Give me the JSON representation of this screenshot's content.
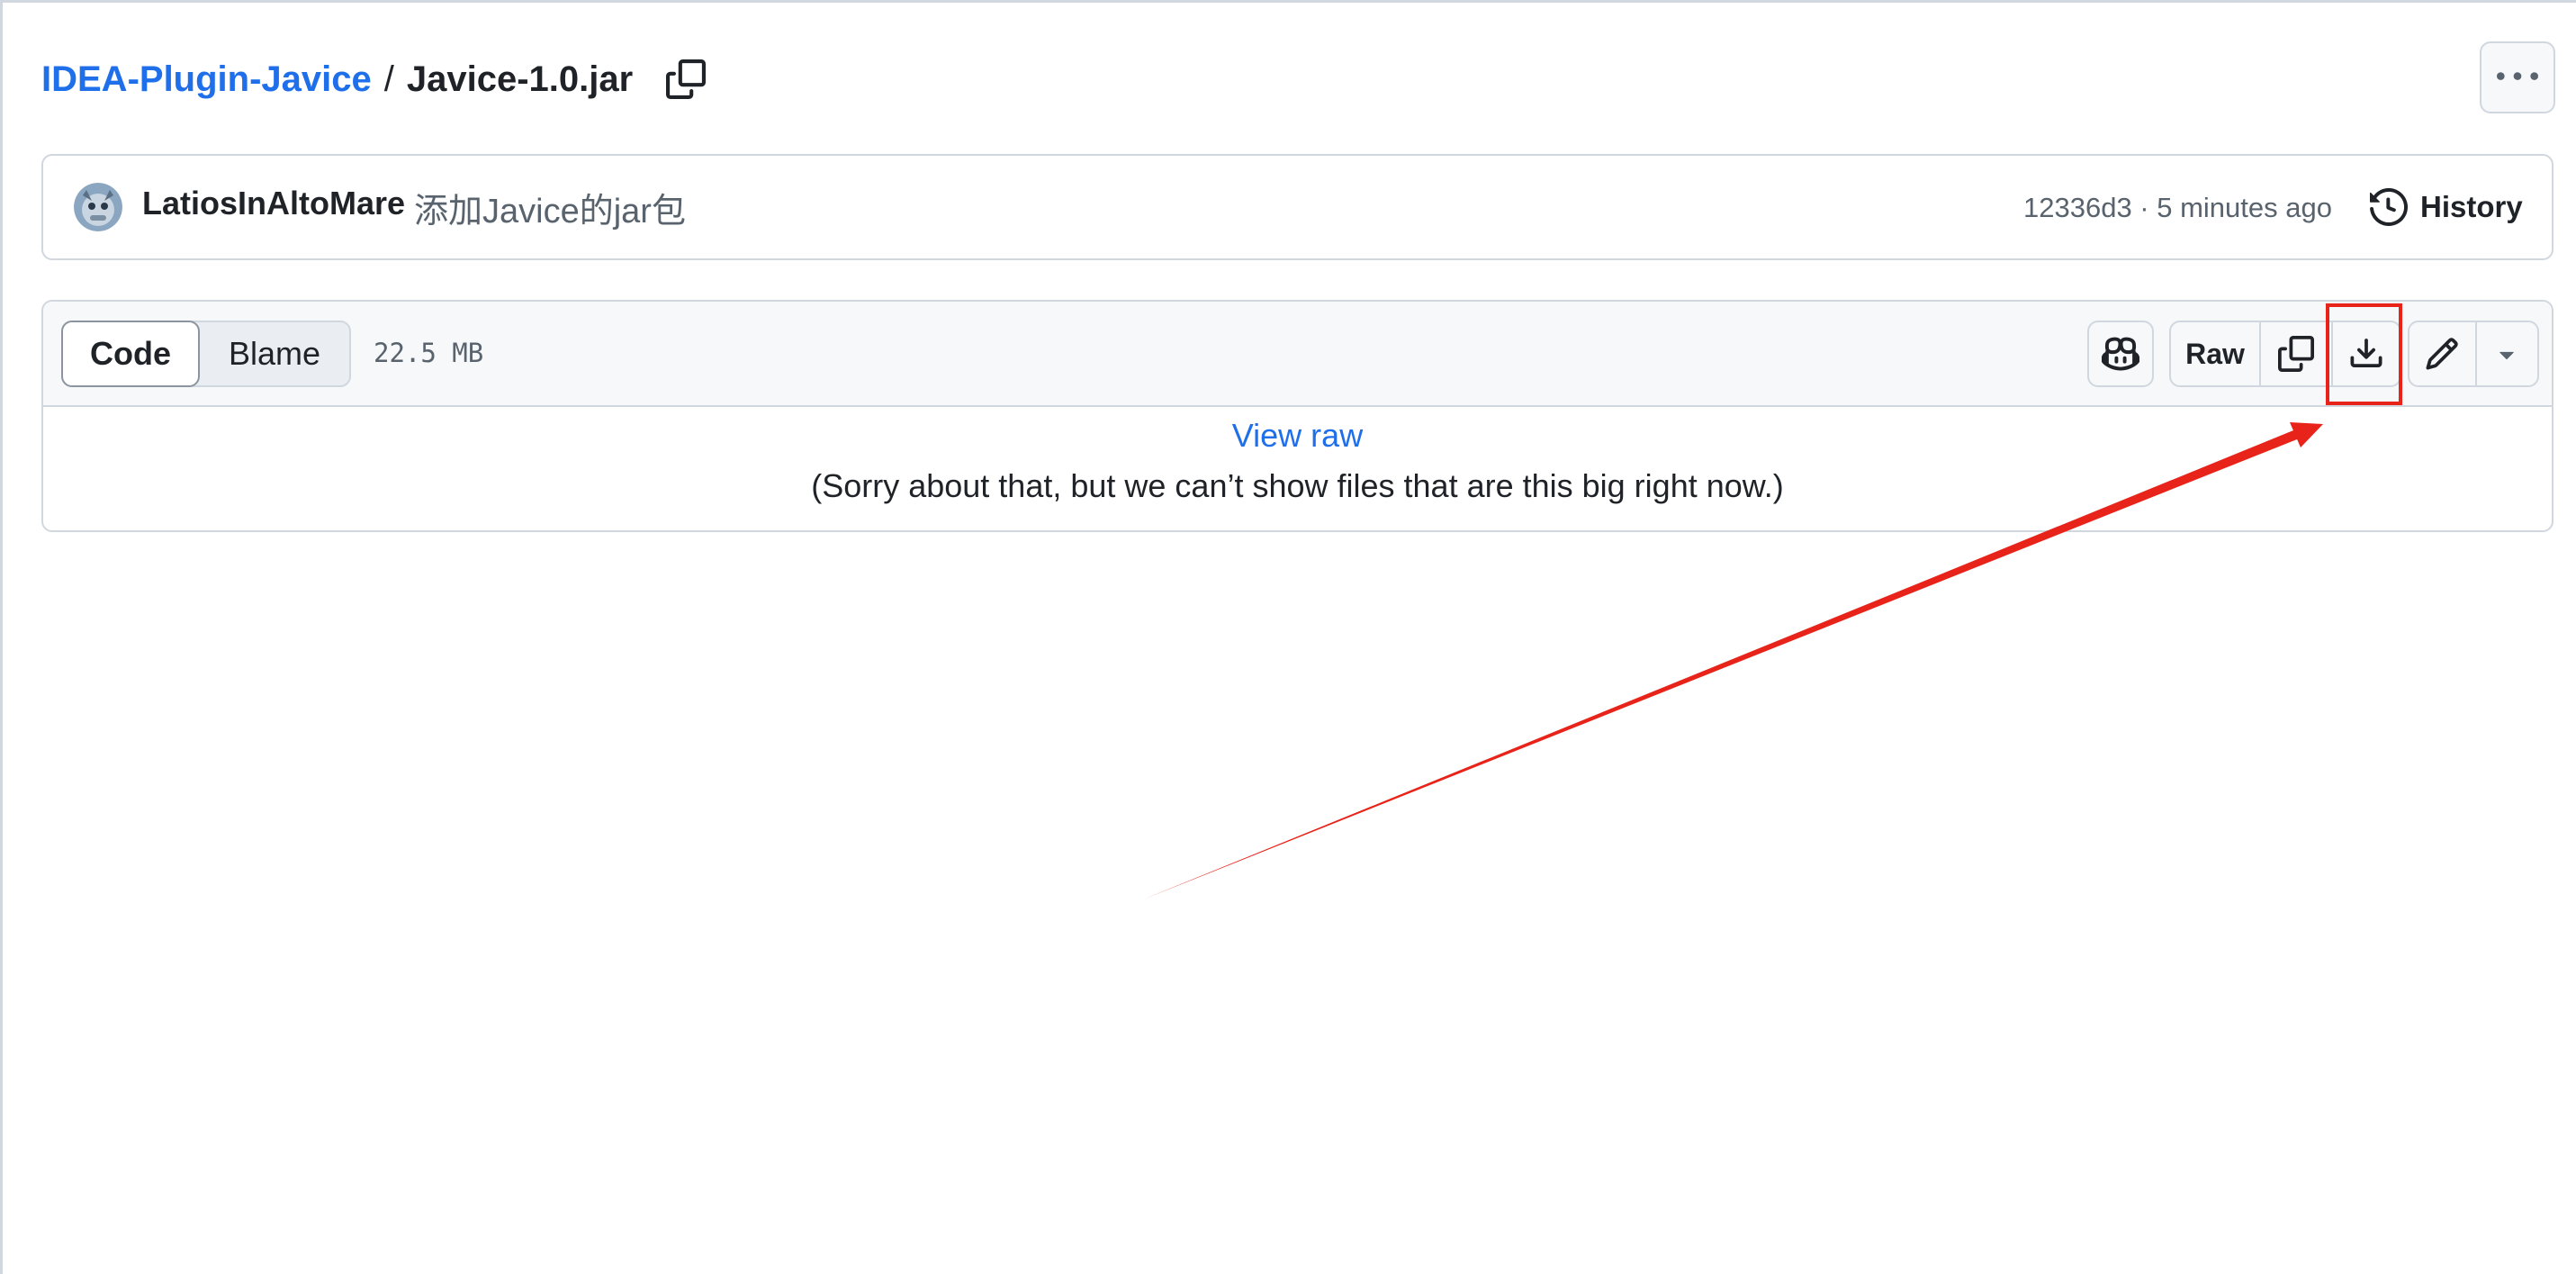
{
  "breadcrumb": {
    "repo": "IDEA-Plugin-Javice",
    "separator": "/",
    "file": "Javice-1.0.jar"
  },
  "commit": {
    "author": "LatiosInAltoMare",
    "message": "添加Javice的jar包",
    "meta": "12336d3 · 5 minutes ago",
    "history_label": "History"
  },
  "file_header": {
    "tabs": [
      {
        "label": "Code",
        "selected": true
      },
      {
        "label": "Blame",
        "selected": false
      }
    ],
    "size": "22.5 MB",
    "raw_label": "Raw"
  },
  "file_body": {
    "view_raw": "View raw",
    "notice": "(Sorry about that, but we can’t show files that are this big right now.)"
  },
  "colors": {
    "link": "#1f6feb",
    "annotation": "#e8231a",
    "border": "#d0d7de"
  },
  "icons": [
    "copy-icon",
    "kebab-icon",
    "history-icon",
    "copilot-icon",
    "download-icon",
    "pencil-icon",
    "triangle-down-icon"
  ]
}
